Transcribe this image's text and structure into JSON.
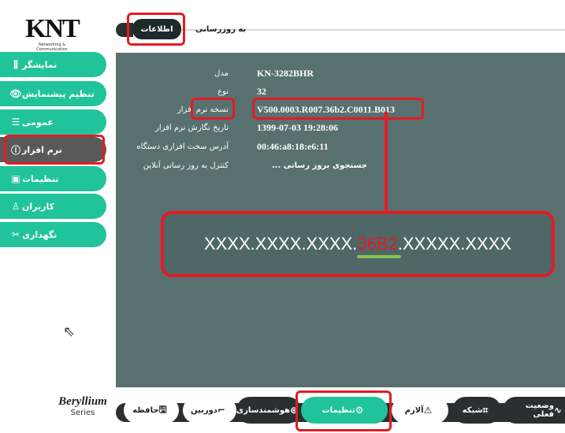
{
  "logo": {
    "text": "KNT",
    "subtitle": "Networking & Communication"
  },
  "sidebar": {
    "items": [
      {
        "label": "نمایشگر",
        "icon": "columns-icon"
      },
      {
        "label": "تنظیم پیشنمایش",
        "icon": "eye-icon"
      },
      {
        "label": "عمومی",
        "icon": "list-icon"
      },
      {
        "label": "نرم افزار",
        "icon": "info-icon",
        "active": true
      },
      {
        "label": "تنظیمات",
        "icon": "settings-icon"
      },
      {
        "label": "کاربران",
        "icon": "user-icon"
      },
      {
        "label": "نگهداری",
        "icon": "tools-icon"
      }
    ]
  },
  "tabs": {
    "info": "اطلاعات",
    "update": "به روزرسانی"
  },
  "info": {
    "rows": [
      {
        "label": "مدل",
        "value": "KN-3282BHR"
      },
      {
        "label": "نوع",
        "value": "32"
      },
      {
        "label": "نسخه نرم افزار",
        "value": "V500.0003.R007.36b2.C0011.B013"
      },
      {
        "label": "تاریخ نگارش نرم افزار",
        "value": "1399-07-03 19:28:06"
      },
      {
        "label": "آدرس سخت افزاری دستگاه",
        "value": "00:46:a8:18:e6:11"
      },
      {
        "label": "کنترل به روز رسانی آنلاین",
        "value": "جستجوی بروز رسانی ..."
      }
    ]
  },
  "callout": {
    "prefix": "XXXX.XXXX.XXXX.",
    "highlight": "36B2",
    "suffix": ".XXXXX.XXXX"
  },
  "bottom": {
    "items": [
      {
        "label": "حافظه",
        "icon": "save-icon"
      },
      {
        "label": "دوربین",
        "icon": "camera-icon"
      },
      {
        "label": "هوشمندسازی",
        "icon": "brain-icon"
      },
      {
        "label": "تنظیمات",
        "icon": "gear-icon"
      },
      {
        "label": "آلارم",
        "icon": "alarm-icon"
      },
      {
        "label": "شبکه",
        "icon": "network-icon"
      },
      {
        "label": "وضعیت فعلی",
        "icon": "pulse-icon"
      }
    ]
  },
  "series": {
    "title": "Beryllium",
    "subtitle": "Series"
  },
  "colors": {
    "accent": "#21c49a",
    "panel": "#597070",
    "highlight": "#e31b23"
  }
}
